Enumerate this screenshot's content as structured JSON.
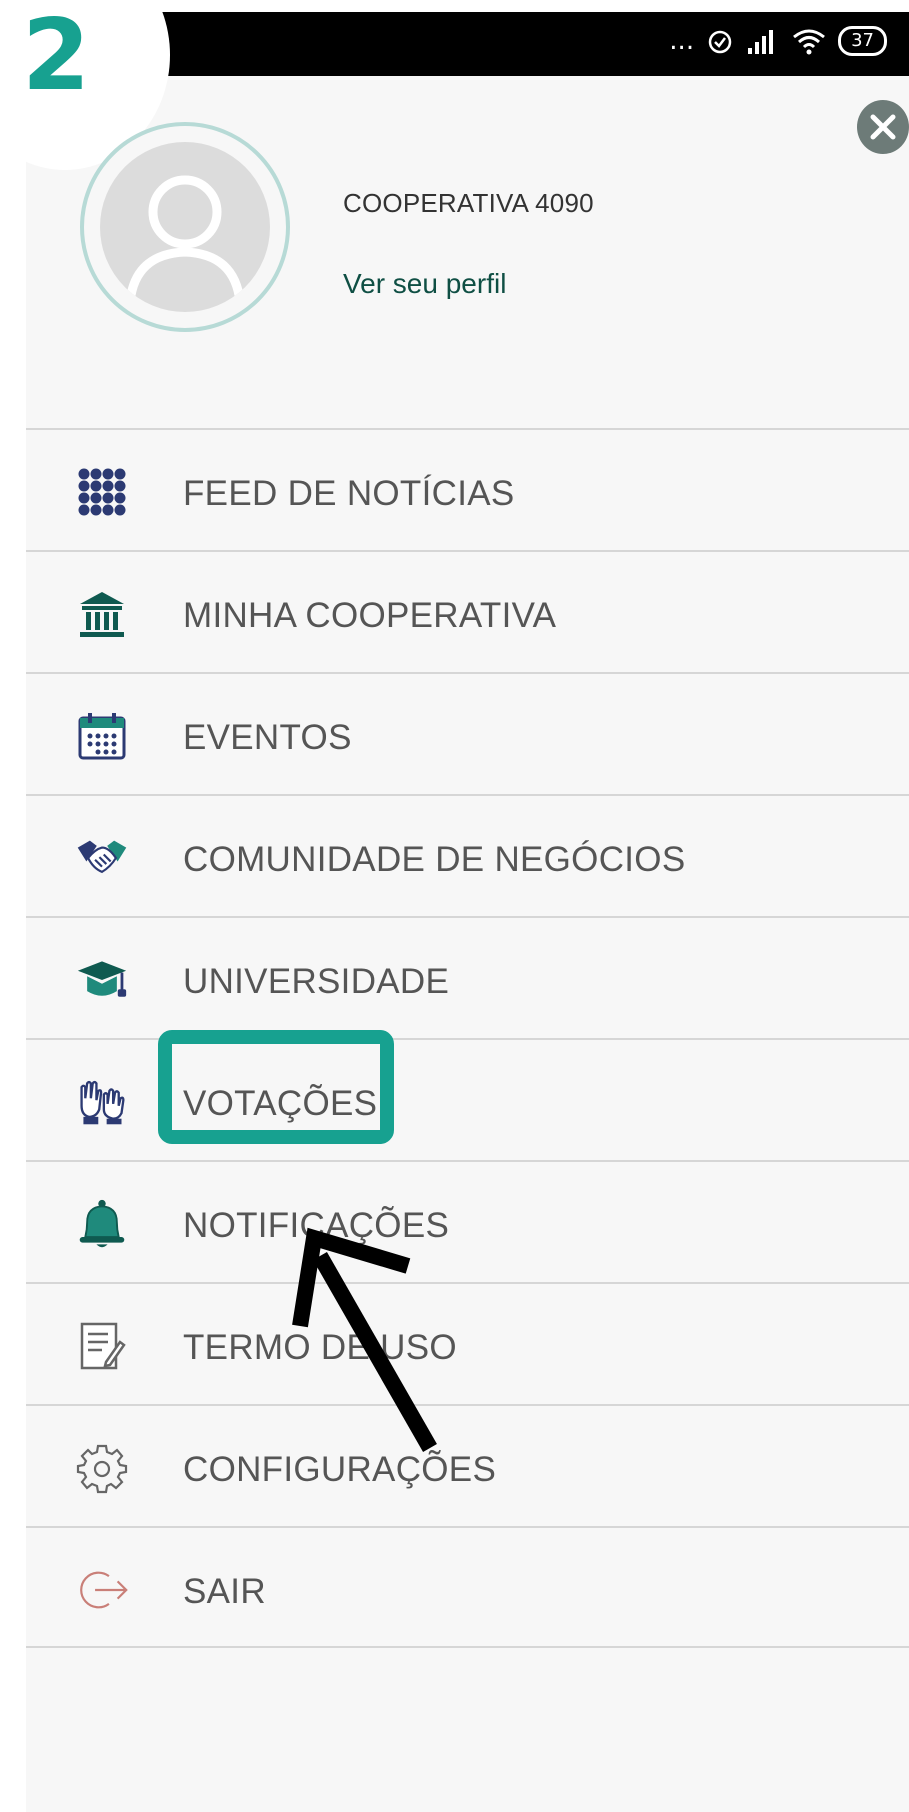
{
  "step_badge": "2",
  "status_bar": {
    "dots": "...",
    "battery": "37"
  },
  "profile": {
    "name": "COOPERATIVA 4090",
    "link": "Ver seu perfil"
  },
  "menu": {
    "items": [
      {
        "label": "FEED DE NOTÍCIAS",
        "icon": "grid-icon"
      },
      {
        "label": "MINHA COOPERATIVA",
        "icon": "bank-icon"
      },
      {
        "label": "EVENTOS",
        "icon": "calendar-icon"
      },
      {
        "label": "COMUNIDADE DE NEGÓCIOS",
        "icon": "handshake-icon"
      },
      {
        "label": "UNIVERSIDADE",
        "icon": "graduation-cap-icon"
      },
      {
        "label": "VOTAÇÕES",
        "icon": "raised-hands-icon"
      },
      {
        "label": "NOTIFICAÇÕES",
        "icon": "bell-icon"
      },
      {
        "label": "TERMO DE USO",
        "icon": "document-icon"
      },
      {
        "label": "CONFIGURAÇÕES",
        "icon": "gear-icon"
      },
      {
        "label": "SAIR",
        "icon": "logout-icon"
      }
    ]
  },
  "colors": {
    "accent": "#17a190",
    "icon_navy": "#2c3a73",
    "icon_teal": "#1f8a7c",
    "link": "#0f4f44",
    "logout": "#c97f78"
  }
}
